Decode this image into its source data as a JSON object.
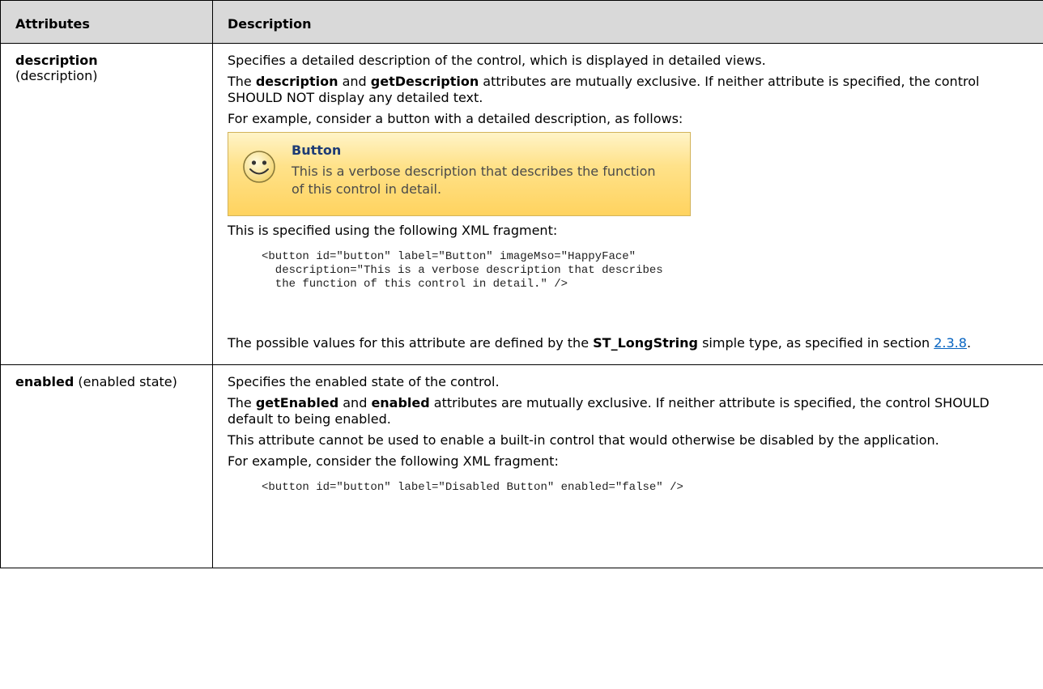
{
  "table": {
    "headers": [
      "Attributes",
      "Description"
    ],
    "rows": [
      {
        "name": "description",
        "name_suffix": "(description)",
        "p1": "Specifies a detailed description of the control, which is displayed in detailed views.",
        "p2": {
          "a": "The ",
          "b1": "description",
          "c": " and ",
          "b2": "getDescription",
          "d": " attributes are mutually exclusive. If neither attribute is specified, the control SHOULD NOT display any detailed text."
        },
        "p3": "For example, consider a button with a detailed description, as follows:",
        "sample": {
          "title": "Button",
          "description": "This is a verbose description that describes the function of this control in detail.",
          "icon": "happy-face-icon"
        },
        "p4": "This is specified using the following XML fragment:",
        "code": "<button id=\"button\" label=\"Button\" imageMso=\"HappyFace\"\n  description=\"This is a verbose description that describes\n  the function of this control in detail.\" />",
        "p5": {
          "a": "The possible values for this attribute are defined by the ",
          "b": "ST_LongString",
          "c": " simple type, as specified in section ",
          "link": "2.3.8",
          "d": "."
        }
      },
      {
        "name": "enabled",
        "name_suffix": "(enabled state)",
        "p1": "Specifies the enabled state of the control.",
        "p2": {
          "a": "The ",
          "b1": "getEnabled",
          "c": " and ",
          "b2": "enabled",
          "d": " attributes are mutually exclusive. If neither attribute is specified, the control SHOULD default to being enabled."
        },
        "p3": "This attribute cannot be used to enable a built-in control that would otherwise be disabled by the application.",
        "p4": "For example, consider the following XML fragment:",
        "code": "<button id=\"button\" label=\"Disabled Button\" enabled=\"false\" />"
      }
    ]
  }
}
